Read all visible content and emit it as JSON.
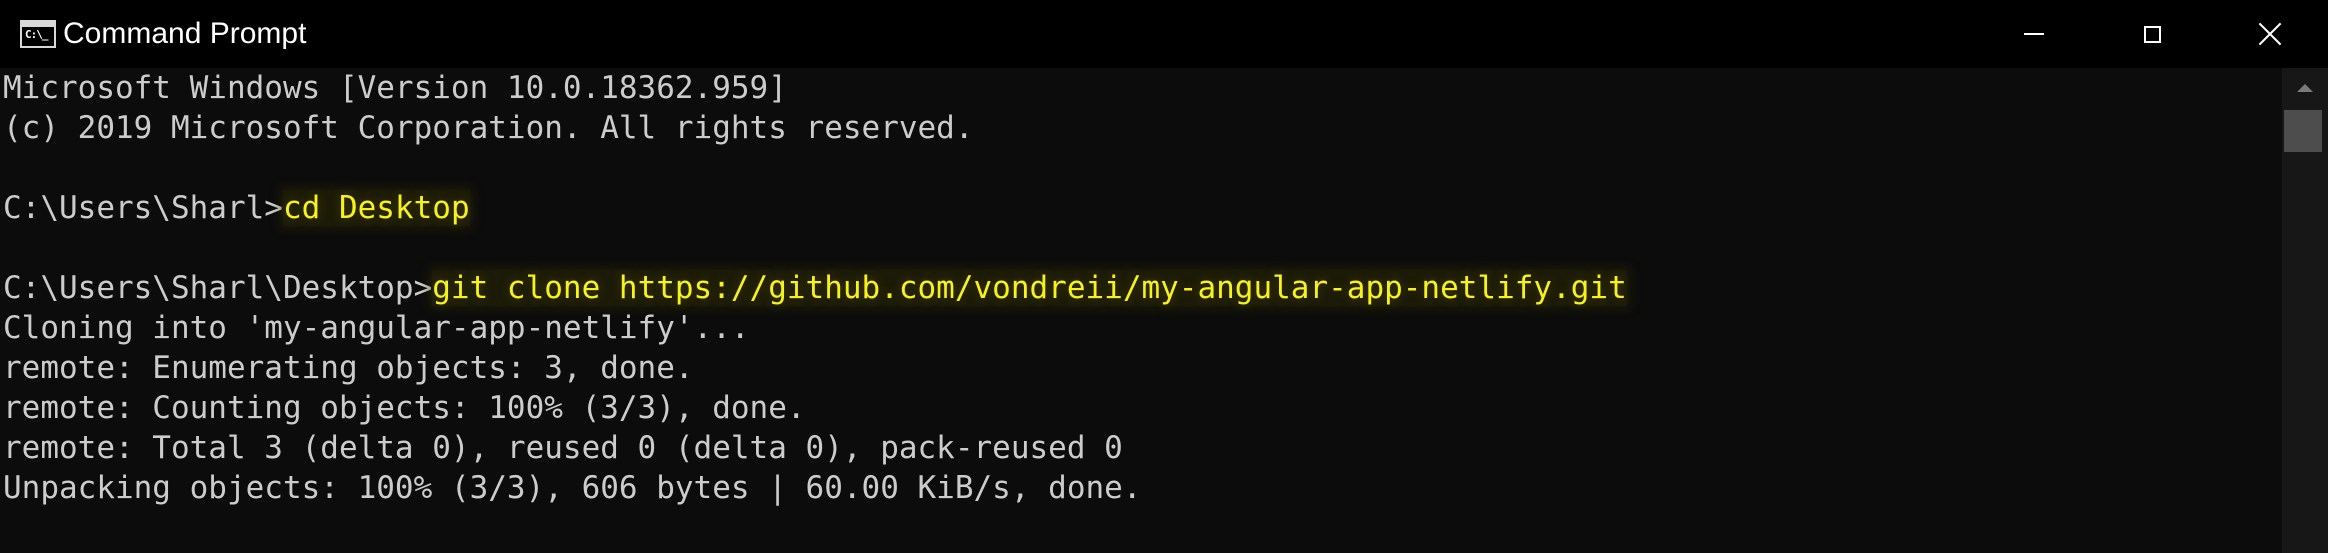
{
  "window": {
    "title": "Command Prompt",
    "icon": "cmd-icon",
    "icon_glyph": "C:\\_"
  },
  "controls": {
    "minimize": "minimize-icon",
    "maximize": "maximize-icon",
    "close": "close-icon"
  },
  "console": {
    "text_color": "#cccccc",
    "highlight_color": "#f7f21a",
    "lines": [
      {
        "prefix": "Microsoft Windows [Version 10.0.18362.959]",
        "command": ""
      },
      {
        "prefix": "(c) 2019 Microsoft Corporation. All rights reserved.",
        "command": ""
      },
      {
        "prefix": "",
        "command": ""
      },
      {
        "prefix": "C:\\Users\\Sharl>",
        "command": "cd Desktop"
      },
      {
        "prefix": "",
        "command": ""
      },
      {
        "prefix": "C:\\Users\\Sharl\\Desktop>",
        "command": "git clone https://github.com/vondreii/my-angular-app-netlify.git"
      },
      {
        "prefix": "Cloning into 'my-angular-app-netlify'...",
        "command": ""
      },
      {
        "prefix": "remote: Enumerating objects: 3, done.",
        "command": ""
      },
      {
        "prefix": "remote: Counting objects: 100% (3/3), done.",
        "command": ""
      },
      {
        "prefix": "remote: Total 3 (delta 0), reused 0 (delta 0), pack-reused 0",
        "command": ""
      },
      {
        "prefix": "Unpacking objects: 100% (3/3), 606 bytes | 60.00 KiB/s, done.",
        "command": ""
      }
    ]
  }
}
